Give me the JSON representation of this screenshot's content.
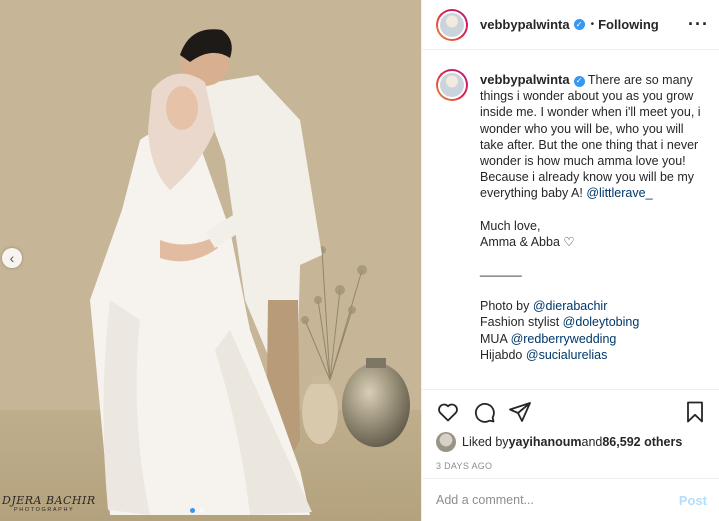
{
  "post": {
    "account": {
      "username": "vebbypalwinta",
      "verified_mark": "✓",
      "separator": "•",
      "follow_status": "Following",
      "more_label": "···"
    },
    "photo": {
      "watermark_main": "DJERA BACHIR",
      "watermark_sub": "PHOTOGRAPHY",
      "prev_label": "‹",
      "carousel_total": 2,
      "carousel_current": 1
    },
    "caption": {
      "username": "vebbypalwinta",
      "text_before_mention": " There are so many things i wonder about you as you grow inside me. I wonder when i'll meet you, i wonder who you will be, who you will take after. But the one thing that i never wonder is how much amma love you! Because i already know you will be my everything baby A! ",
      "mention_1": "@littlerave_",
      "sign_off_1": "Much love,",
      "sign_off_2": "Amma & Abba ",
      "heart": "♡",
      "divider": "______",
      "credits": [
        {
          "label": "Photo by ",
          "handle": "@dierabachir"
        },
        {
          "label": "Fashion stylist ",
          "handle": "@doleytobing"
        },
        {
          "label": "MUA ",
          "handle": "@redberrywedding"
        },
        {
          "label": "Hijabdo ",
          "handle": "@sucialurelias"
        }
      ]
    },
    "actions": {
      "like_icon": "heart-outline",
      "comment_icon": "speech-bubble",
      "share_icon": "paper-plane",
      "save_icon": "bookmark"
    },
    "likes": {
      "prefix": "Liked by ",
      "user": "yayihanoum",
      "middle": " and ",
      "count": "86,592 others"
    },
    "timestamp": "3 DAYS AGO",
    "comment_box": {
      "placeholder": "Add a comment...",
      "post_label": "Post"
    },
    "colors": {
      "accent": "#3897f0",
      "post_disabled": "#b2dffc",
      "mention": "#00376b",
      "muted": "#8e8e8e"
    }
  }
}
